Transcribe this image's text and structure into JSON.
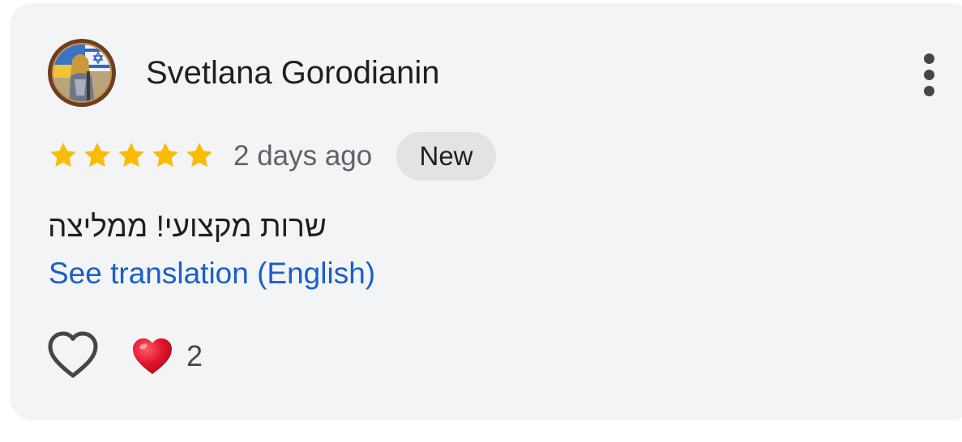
{
  "review": {
    "author": "Svetlana Gorodianin",
    "rating": 5,
    "rating_max": 5,
    "time": "2 days ago",
    "badge": "New",
    "text": "שרות מקצועי! ממליצה",
    "translation_link": "See translation (English)",
    "reaction_count": "2"
  },
  "icons": {
    "more": "more-vert-icon",
    "star": "star-icon",
    "like": "heart-outline-icon",
    "reaction": "red-heart-emoji"
  },
  "colors": {
    "card_bg": "#f3f4f6",
    "star": "#fbbc04",
    "link": "#1a5fc7",
    "badge_bg": "#e3e3e3",
    "reaction_heart": "#e0162b"
  }
}
